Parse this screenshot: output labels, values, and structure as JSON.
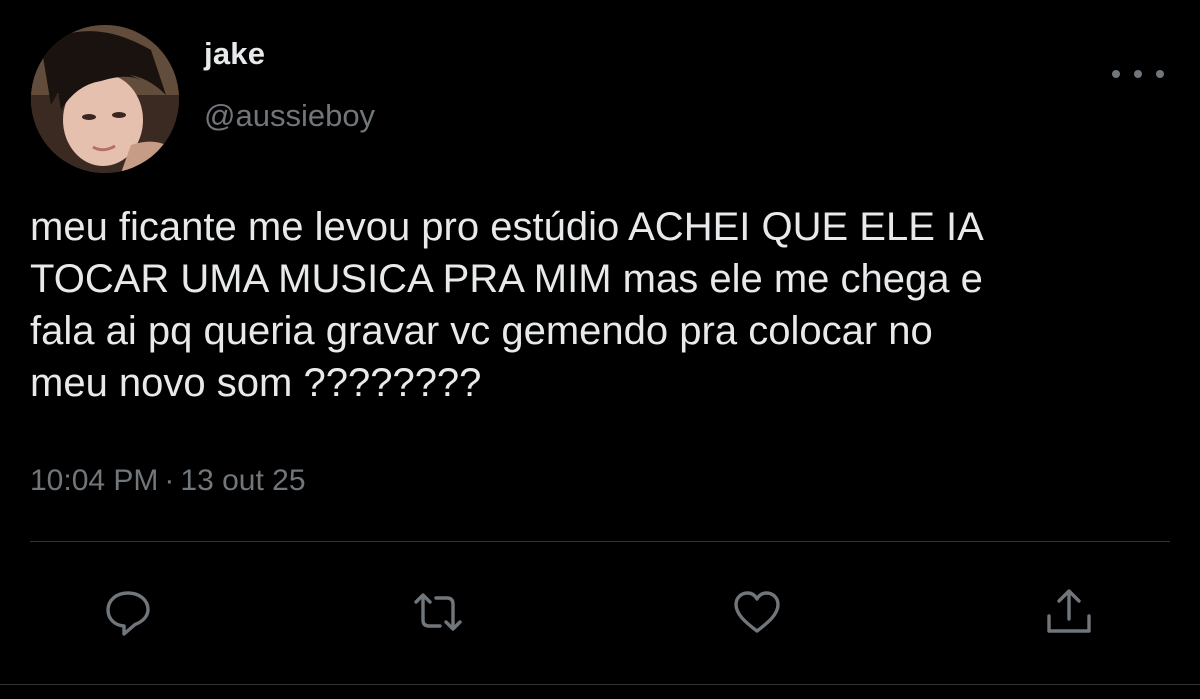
{
  "user": {
    "display_name": "jake",
    "handle": "@aussieboy"
  },
  "tweet": {
    "text": "meu ficante me levou pro estúdio ACHEI QUE ELE IA\nTOCAR UMA MUSICA PRA MIM mas ele me chega e\nfala ai pq queria gravar vc gemendo pra colocar no\nmeu novo som ????????",
    "time": "10:04 PM",
    "separator": "·",
    "date": "13 out 25"
  },
  "icons": {
    "more": "more-dots-icon",
    "reply": "reply-icon",
    "retweet": "retweet-icon",
    "like": "heart-icon",
    "share": "share-icon"
  },
  "colors": {
    "background": "#000000",
    "text": "#e7e9ea",
    "secondary": "#71767b",
    "divider": "#2f3336"
  }
}
